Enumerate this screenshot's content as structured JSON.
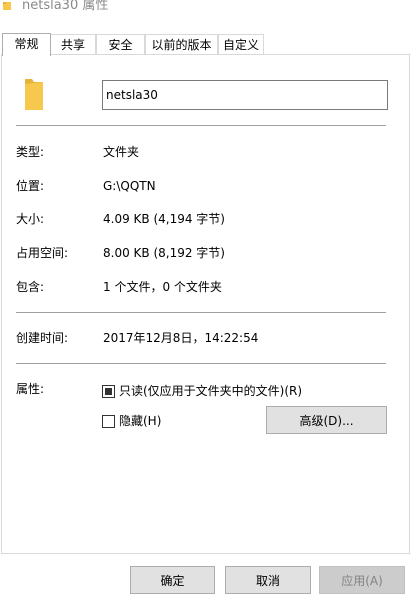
{
  "window": {
    "title": "netsla30 属性"
  },
  "tabs": [
    {
      "label": "常规",
      "active": true
    },
    {
      "label": "共享"
    },
    {
      "label": "安全"
    },
    {
      "label": "以前的版本"
    },
    {
      "label": "自定义"
    }
  ],
  "general": {
    "folder_name": "netsla30",
    "rows": [
      {
        "label": "类型:",
        "value": "文件夹"
      },
      {
        "label": "位置:",
        "value": "G:\\QQTN"
      },
      {
        "label": "大小:",
        "value": "4.09 KB (4,194 字节)"
      },
      {
        "label": "占用空间:",
        "value": "8.00 KB (8,192 字节)"
      },
      {
        "label": "包含:",
        "value": "1 个文件，0 个文件夹"
      }
    ],
    "created": {
      "label": "创建时间:",
      "value": "2017年12月8日，14:22:54"
    },
    "attributes": {
      "label": "属性:",
      "readonly_label": "只读(仅应用于文件夹中的文件)(R)",
      "readonly_state": "indeterminate",
      "hidden_label": "隐藏(H)",
      "hidden_checked": false,
      "advanced_label": "高级(D)..."
    }
  },
  "footer": {
    "ok_label": "确定",
    "cancel_label": "取消",
    "apply_label": "应用(A)"
  },
  "colors": {
    "folder": "#f6c94e",
    "folder_dark": "#e6b33b",
    "divider": "#a0a0a0",
    "button_bg": "#e1e1e1"
  }
}
